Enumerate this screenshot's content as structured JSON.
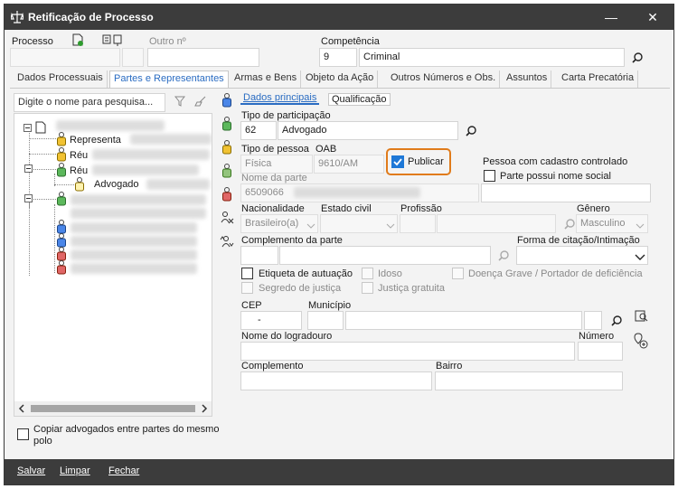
{
  "window": {
    "title": "Retificação de Processo",
    "minimize_glyph": "—",
    "close_glyph": "✕"
  },
  "header": {
    "processo_label": "Processo",
    "outro_label": "Outro nº",
    "competencia_label": "Competência",
    "competencia_code": "9",
    "competencia_name": "Criminal"
  },
  "tabs": [
    {
      "label": "Dados Processuais"
    },
    {
      "label": "Partes e Representantes"
    },
    {
      "label": "Armas e Bens"
    },
    {
      "label": "Objeto da Ação"
    },
    {
      "label": "Outros Números e Obs."
    },
    {
      "label": "Assuntos"
    },
    {
      "label": "Carta Precatória"
    }
  ],
  "left_panel": {
    "search_placeholder": "Digite o nome para pesquisa...",
    "tree": [
      {
        "label": "Representa"
      },
      {
        "label": "Réu"
      },
      {
        "label": "Réu"
      },
      {
        "label": "Advogado"
      }
    ],
    "copy_label": "Copiar advogados entre partes do mesmo polo"
  },
  "subtabs": [
    {
      "label": "Dados principais"
    },
    {
      "label": "Qualificação"
    }
  ],
  "form": {
    "tipo_participacao_label": "Tipo de participação",
    "tipo_participacao_code": "62",
    "tipo_participacao_name": "Advogado",
    "tipo_pessoa_label": "Tipo de pessoa",
    "tipo_pessoa_value": "Física",
    "oab_label": "OAB",
    "oab_value": "9610/AM",
    "publicar_label": "Publicar",
    "cadastro_controlado_label": "Pessoa com cadastro controlado",
    "nome_social_label": "Parte possui nome social",
    "nome_parte_label": "Nome da parte",
    "nome_parte_value": "6509066",
    "nacionalidade_label": "Nacionalidade",
    "nacionalidade_value": "Brasileiro(a)",
    "estado_civil_label": "Estado civil",
    "profissao_label": "Profissão",
    "genero_label": "Gênero",
    "genero_value": "Masculino",
    "complemento_parte_label": "Complemento da parte",
    "forma_citacao_label": "Forma de citação/Intimação",
    "etiqueta_label": "Etiqueta de autuação",
    "idoso_label": "Idoso",
    "doenca_label": "Doença Grave / Portador de deficiência",
    "segredo_label": "Segredo de justiça",
    "justica_gratuita_label": "Justiça gratuita",
    "cep_label": "CEP",
    "cep_value": "-",
    "municipio_label": "Município",
    "logradouro_label": "Nome do logradouro",
    "numero_label": "Número",
    "complemento_label": "Complemento",
    "bairro_label": "Bairro"
  },
  "footer": {
    "salvar": "Salvar",
    "limpar": "Limpar",
    "fechar": "Fechar"
  },
  "colors": {
    "titlebar": "#3c3c3c",
    "accent": "#2a6cc2",
    "highlight_border": "#e07b1a",
    "check_blue": "#1e78d7"
  }
}
